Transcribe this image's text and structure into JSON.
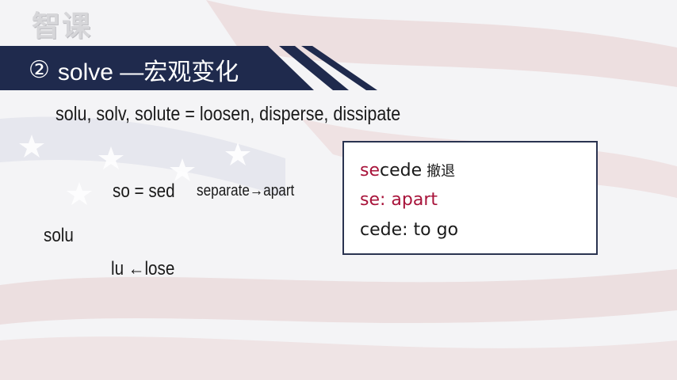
{
  "watermark": "智课",
  "header": {
    "number": "②",
    "title": "solve —宏观变化"
  },
  "content": {
    "definition": "solu, solv, solute = loosen, disperse, dissipate",
    "so_equation": "so = sed",
    "separate_line": "separate→apart",
    "solu": "solu",
    "lu_line": "lu ←lose"
  },
  "card": {
    "line1_prefix": "se",
    "line1_rest": "cede",
    "line1_zh": "撤退",
    "line2": "se: apart",
    "line3": "cede: to go"
  },
  "colors": {
    "banner": "#1f2a4d",
    "accent_red": "#a8133a",
    "card_border": "#2a3350"
  }
}
